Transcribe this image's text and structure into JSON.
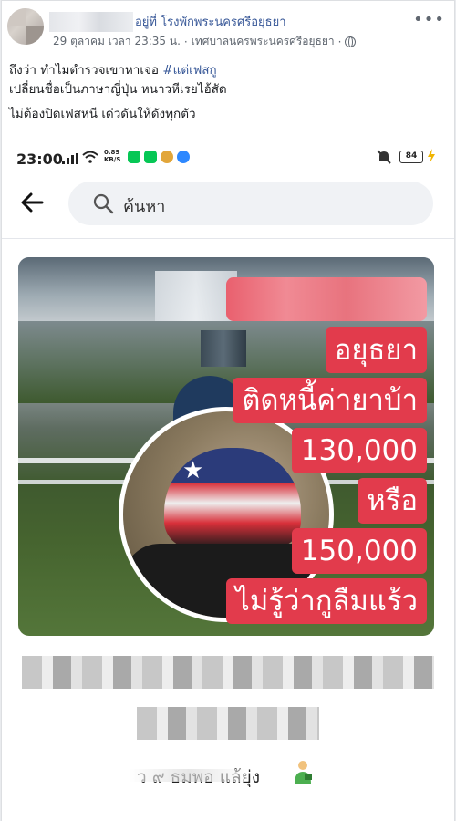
{
  "post": {
    "page_suffix": "อยู่ที่ โรงพักพระนครศรีอยุธยา",
    "date": "29 ตุลาคม เวลา 23:35 น.",
    "separator": "·",
    "location": "เทศบาลนครพระนครศรีอยุธยา",
    "more_label": "•••",
    "caption_line1_text": "ถึงว่า ทำไมตำรวจเขาหาเจอ ",
    "caption_line1_hashtag": "#แต่เฟสกู",
    "caption_line2": "เปลี่ยนชื่อเป็นภาษาญี่ปุ่น หนาวหีเรยไอ้สัด",
    "caption_line3": "ไม่ต้องปิดเฟสหนี เด๋วดันให้ดังทุกตัว"
  },
  "phone": {
    "time": "23:00",
    "net_speed_top": "0.89",
    "net_speed_unit": "KB/S",
    "battery": "84",
    "app_icons": [
      {
        "name": "line-icon",
        "color": "#06c755"
      },
      {
        "name": "line-icon-2",
        "color": "#06c755"
      },
      {
        "name": "chrome-icon",
        "color": "#e2a63a"
      },
      {
        "name": "messenger-icon",
        "color": "#2d88ff"
      }
    ],
    "search_placeholder": "ค้นหา"
  },
  "story": {
    "overlay_lines": [
      "อยุธยา",
      "ติดหนี้ค่ายาบ้า",
      "130,000",
      "หรือ",
      "150,000",
      "ไม่รู้ว่ากูลืมแร้ว"
    ],
    "overlay_color": "#e23b4c"
  },
  "below": {
    "partial_text": "ว ๙ ธมพอ แล้ยุ่ง"
  }
}
